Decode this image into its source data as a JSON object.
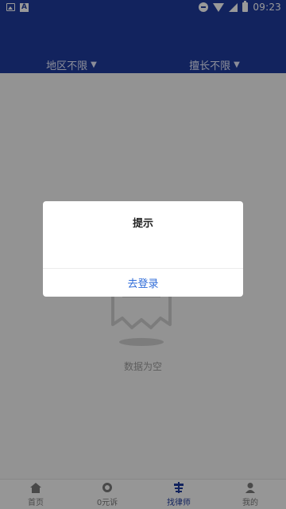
{
  "status_bar": {
    "time": "09:23",
    "icons": [
      "image-notification-icon",
      "a-notification-icon",
      "do-not-disturb-icon",
      "wifi-icon",
      "signal-icon",
      "battery-icon"
    ]
  },
  "filters": [
    {
      "label": "地区不限",
      "caret": "▼"
    },
    {
      "label": "擅长不限",
      "caret": "▼"
    }
  ],
  "empty_state": {
    "text": "数据为空"
  },
  "bottom_nav": [
    {
      "label": "首页",
      "icon": "home-icon",
      "active": false
    },
    {
      "label": "0元诉",
      "icon": "circle-icon",
      "active": false
    },
    {
      "label": "找律师",
      "icon": "lawyer-icon",
      "active": true
    },
    {
      "label": "我的",
      "icon": "profile-icon",
      "active": false
    }
  ],
  "dialog": {
    "title": "提示",
    "button_label": "去登录"
  },
  "colors": {
    "header": "#1f3b9d",
    "accent": "#2e6bd8",
    "overlay": "rgba(0,0,0,0.4)"
  }
}
